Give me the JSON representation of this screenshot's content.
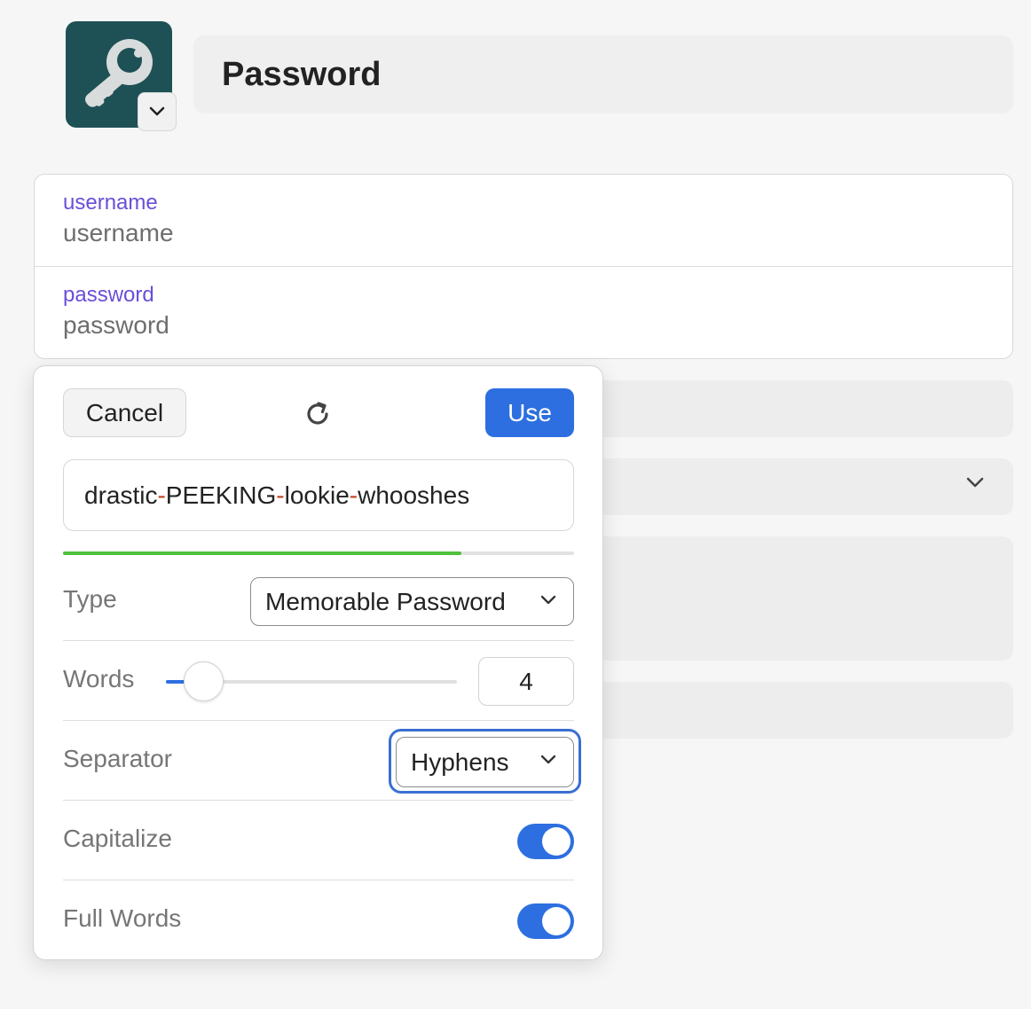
{
  "item": {
    "icon": "key-icon",
    "icon_bg": "#1e5155",
    "title": "Password"
  },
  "credentials": {
    "username": {
      "label": "username",
      "value": "username"
    },
    "password": {
      "label": "password",
      "value": "password"
    }
  },
  "generator": {
    "cancel_label": "Cancel",
    "refresh_icon": "refresh-icon",
    "use_label": "Use",
    "generated_password": {
      "words": [
        "drastic",
        "PEEKING",
        "lookie",
        "whooshes"
      ],
      "separator": "-"
    },
    "strength": 0.78,
    "strength_color": "#4fc13a",
    "options": {
      "type": {
        "label": "Type",
        "value": "Memorable Password"
      },
      "words": {
        "label": "Words",
        "value": "4",
        "slider_fraction": 0.13
      },
      "separator": {
        "label": "Separator",
        "value": "Hyphens",
        "focused": true
      },
      "capitalize": {
        "label": "Capitalize",
        "on": true
      },
      "full_words": {
        "label": "Full Words",
        "on": true
      }
    }
  },
  "colors": {
    "accent": "#2d6fe0",
    "label_purple": "#6a4fd8",
    "separator_char": "#c0431f"
  }
}
